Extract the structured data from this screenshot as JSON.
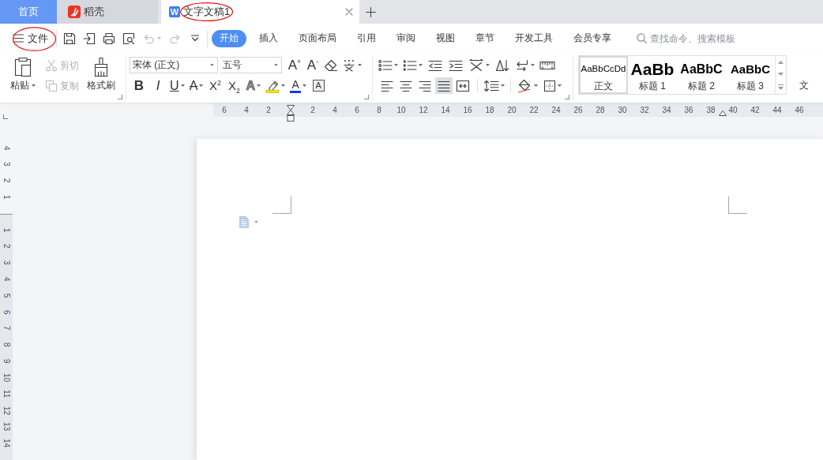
{
  "title_tabs": [
    {
      "kind": "home",
      "label": "首页",
      "selected": false
    },
    {
      "kind": "docer",
      "label": "稻壳",
      "selected": false
    },
    {
      "kind": "document",
      "logo": "W",
      "label": "文字文稿1",
      "selected": true,
      "circled": true
    }
  ],
  "file_menu": {
    "label": "文件",
    "circled": true
  },
  "quick_access": [
    {
      "kind": "save",
      "disabled": false
    },
    {
      "kind": "export",
      "disabled": false
    },
    {
      "kind": "print",
      "disabled": false
    },
    {
      "kind": "preview",
      "disabled": false
    },
    {
      "kind": "undo",
      "disabled": true,
      "menu": true
    },
    {
      "kind": "redo",
      "disabled": true
    },
    {
      "kind": "customize",
      "disabled": false
    }
  ],
  "ribbon_tabs": [
    {
      "label": "开始",
      "selected": true
    },
    {
      "label": "插入",
      "selected": false
    },
    {
      "label": "页面布局",
      "selected": false
    },
    {
      "label": "引用",
      "selected": false
    },
    {
      "label": "审阅",
      "selected": false
    },
    {
      "label": "视图",
      "selected": false
    },
    {
      "label": "章节",
      "selected": false
    },
    {
      "label": "开发工具",
      "selected": false
    },
    {
      "label": "会员专享",
      "selected": false
    }
  ],
  "search": {
    "placeholder": "查找命令、搜索模板"
  },
  "clipboard": [
    {
      "kind": "paste",
      "label": "粘贴",
      "disabled": false,
      "menu": true
    },
    {
      "kind": "cut",
      "label": "剪切",
      "disabled": true
    },
    {
      "kind": "copy",
      "label": "复制",
      "disabled": true
    },
    {
      "kind": "format_painter",
      "label": "格式刷",
      "disabled": false
    }
  ],
  "font": {
    "family": "宋体 (正文)",
    "size": "五号",
    "row_1": [
      {
        "kind": "grow",
        "label": "A$^{+}$"
      },
      {
        "kind": "shrink",
        "label": "A$^{-}$"
      },
      {
        "kind": "clear"
      },
      {
        "kind": "pinyin",
        "menu": true
      }
    ],
    "row_2": [
      {
        "kind": "bold",
        "label": "B"
      },
      {
        "kind": "italic",
        "label": "I"
      },
      {
        "kind": "underline",
        "label": "U",
        "menu": true
      },
      {
        "kind": "strike",
        "label": "A",
        "menu": true
      },
      {
        "kind": "superscript",
        "label": "X$^{2}$"
      },
      {
        "kind": "subscript",
        "label": "X$_{2}$"
      },
      {
        "kind": "effect",
        "label": "A",
        "menu": true
      },
      {
        "kind": "highlight",
        "menu": true
      },
      {
        "kind": "color",
        "label": "A",
        "menu": true
      },
      {
        "kind": "border",
        "label": "A"
      }
    ]
  },
  "paragraph": {
    "row_1": [
      {
        "kind": "bullets",
        "menu": true
      },
      {
        "kind": "numbering",
        "menu": true
      },
      {
        "kind": "outdent"
      },
      {
        "kind": "indent"
      },
      {
        "kind": "layout",
        "menu": true
      },
      {
        "kind": "sort"
      },
      {
        "kind": "marks",
        "menu": true
      },
      {
        "kind": "ruler"
      }
    ],
    "alignment": [
      {
        "kind": "left",
        "selected": false
      },
      {
        "kind": "center",
        "selected": false
      },
      {
        "kind": "right",
        "selected": false
      },
      {
        "kind": "justify",
        "selected": true
      },
      {
        "kind": "distribute",
        "selected": false
      }
    ],
    "row_2": [
      {
        "kind": "spacing",
        "menu": true
      },
      {
        "kind": "shading",
        "menu": true
      },
      {
        "kind": "borders",
        "menu": true
      }
    ]
  },
  "styles": [
    {
      "preview": "AaBbCcDd",
      "name": "正文",
      "selected": true
    },
    {
      "preview": "AaBb",
      "name": "标题 1",
      "selected": false
    },
    {
      "preview": "AaBbC",
      "name": "标题 2",
      "selected": false
    },
    {
      "preview": "AaBbC",
      "name": "标题 3",
      "selected": false
    }
  ],
  "cut_off_button": {
    "label": "文"
  },
  "horizontal_ruler": {
    "left_labels": [
      "6",
      "4",
      "2"
    ],
    "right_labels": [
      "2",
      "4",
      "6",
      "8",
      "10",
      "12",
      "14",
      "16",
      "18",
      "20",
      "22",
      "24",
      "26",
      "28",
      "30",
      "32",
      "34",
      "36",
      "38",
      "40",
      "42",
      "44",
      "46"
    ]
  },
  "vertical_ruler": {
    "top_labels": [
      "4",
      "3",
      "2",
      "1"
    ],
    "body_labels": [
      "1",
      "2",
      "3",
      "4",
      "5",
      "6",
      "7",
      "8",
      "9",
      "10",
      "11",
      "12",
      "13",
      "14"
    ]
  }
}
